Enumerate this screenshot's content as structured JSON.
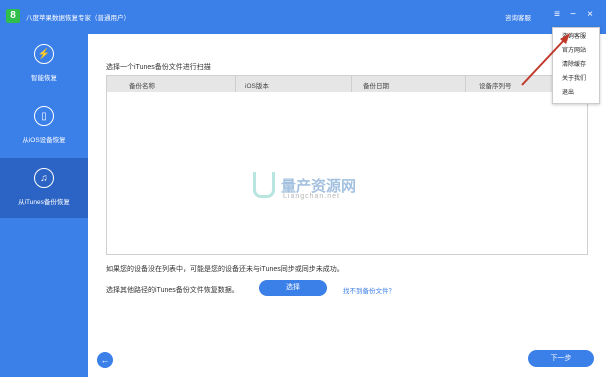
{
  "titlebar": {
    "logo_text": "8",
    "app_title": "八度苹果数据恢复专家（普通用户）",
    "service_link": "咨询客服",
    "menu_icon": "≡",
    "minimize_icon": "−",
    "close_icon": "×"
  },
  "sidebar": {
    "items": [
      {
        "label": "智能恢复",
        "icon": "⚡"
      },
      {
        "label": "从iOS设备恢复",
        "icon": "▯"
      },
      {
        "label": "从iTunes备份恢复",
        "icon": "♫"
      }
    ]
  },
  "main": {
    "title": "选择一个iTunes备份文件进行扫描",
    "columns": [
      "备份名称",
      "iOS版本",
      "备份日期",
      "设备序列号"
    ],
    "hint_not_listed": "如果您的设备没在列表中，可能是您的设备还未与iTunes同步或同步未成功。",
    "hint_choose_other": "选择其他路径的iTunes备份文件恢复数据。",
    "select_button": "选择",
    "not_found_link": "找不到备份文件？",
    "back_icon": "←",
    "next_button": "下一步"
  },
  "dropdown": {
    "items": [
      "咨询客服",
      "官方网站",
      "清除缓存",
      "关于我们",
      "退出"
    ]
  },
  "watermark": {
    "text": "量产资源网",
    "sub": "Liangchan.net"
  },
  "colors": {
    "accent": "#3b7fe8",
    "sidebar_active": "#2b64c4",
    "arrow": "#c0392b"
  }
}
